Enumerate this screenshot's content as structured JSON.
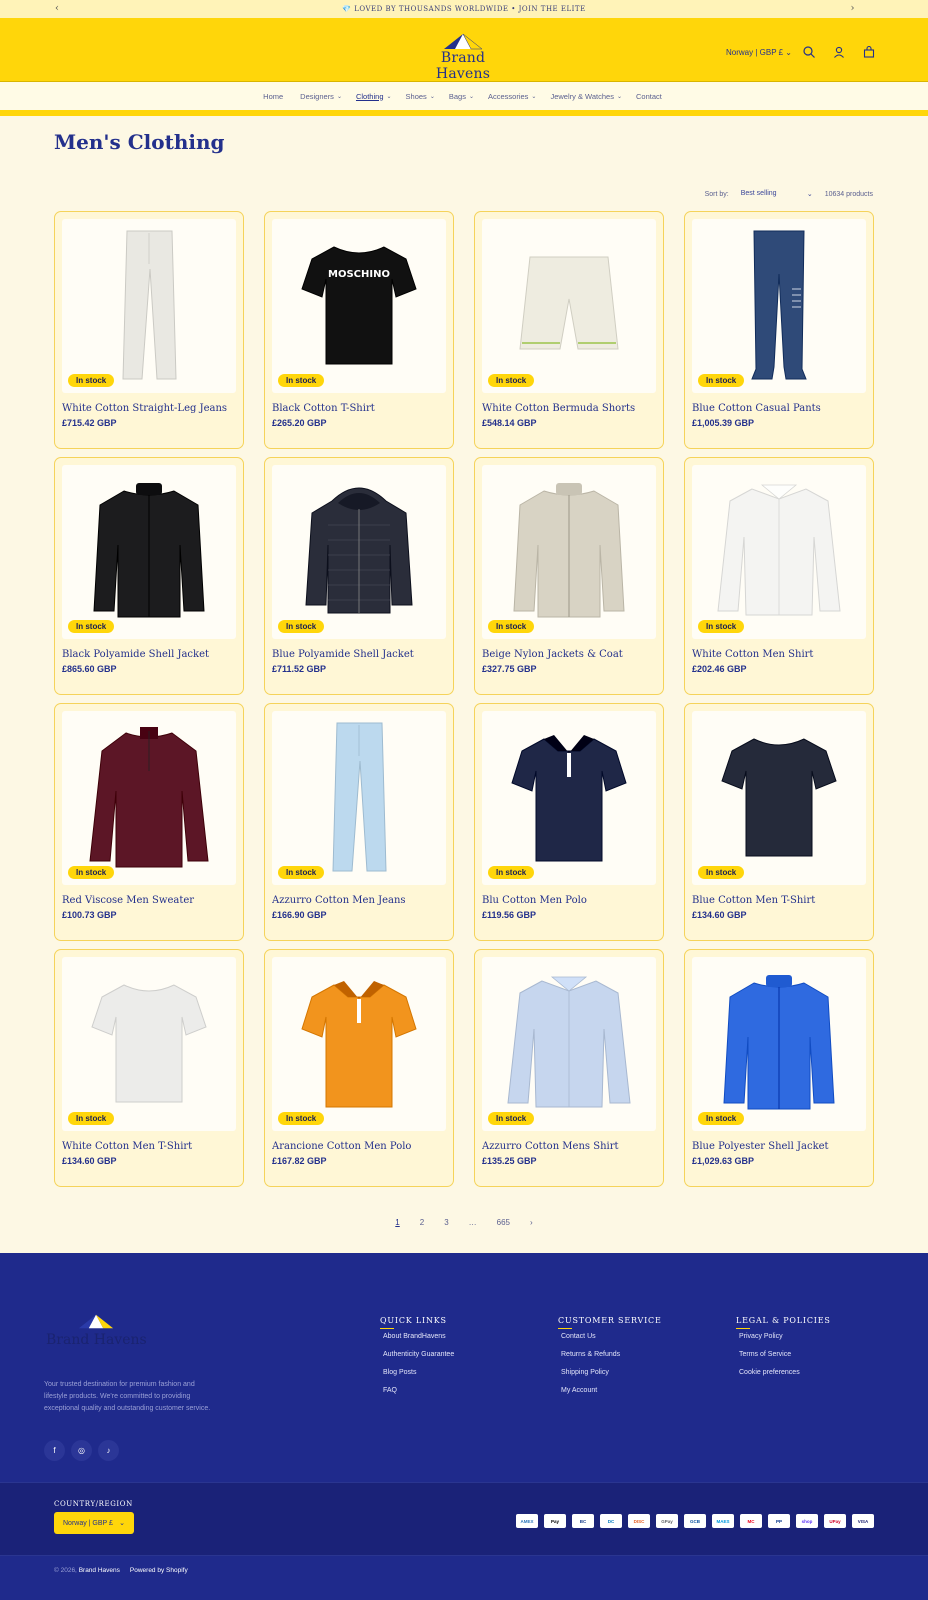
{
  "announcement": {
    "text": "💎 LOVED BY THOUSANDS WORLDWIDE • JOIN THE ELITE",
    "prev": "‹",
    "next": "›"
  },
  "header": {
    "brand": "Brand Havens",
    "locale": "Norway | GBP £"
  },
  "nav": [
    {
      "label": "Home",
      "chev": ""
    },
    {
      "label": "Designers",
      "chev": "⌄"
    },
    {
      "label": "Clothing",
      "chev": "⌄"
    },
    {
      "label": "Shoes",
      "chev": "⌄"
    },
    {
      "label": "Bags",
      "chev": "⌄"
    },
    {
      "label": "Accessories",
      "chev": "⌄"
    },
    {
      "label": "Jewelry & Watches",
      "chev": "⌄"
    },
    {
      "label": "Contact",
      "chev": ""
    }
  ],
  "page": {
    "title": "Men's Clothing"
  },
  "sort": {
    "label": "Sort by:",
    "value": "Best selling",
    "count": "10634 products"
  },
  "products": [
    {
      "name": "White Cotton Straight-Leg Jeans",
      "price": "£715.42 GBP",
      "badge": "In stock",
      "kind": "pants",
      "color": "#e9e8e2"
    },
    {
      "name": "Black Cotton T-Shirt",
      "price": "£265.20 GBP",
      "badge": "In stock",
      "kind": "tee",
      "color": "#111111",
      "print": "MOSCHINO"
    },
    {
      "name": "White Cotton Bermuda Shorts",
      "price": "£548.14 GBP",
      "badge": "In stock",
      "kind": "shorts",
      "color": "#eeece0"
    },
    {
      "name": "Blue Cotton Casual Pants",
      "price": "£1,005.39 GBP",
      "badge": "In stock",
      "kind": "joggers",
      "color": "#2f4a78"
    },
    {
      "name": "Black Polyamide Shell Jacket",
      "price": "£865.60 GBP",
      "badge": "In stock",
      "kind": "jacket",
      "color": "#1c1c1e"
    },
    {
      "name": "Blue Polyamide Shell Jacket",
      "price": "£711.52 GBP",
      "badge": "In stock",
      "kind": "hoodie",
      "color": "#2a2d3a"
    },
    {
      "name": "Beige Nylon Jackets & Coat",
      "price": "£327.75 GBP",
      "badge": "In stock",
      "kind": "jacket",
      "color": "#d8d3c4"
    },
    {
      "name": "White Cotton Men Shirt",
      "price": "£202.46 GBP",
      "badge": "In stock",
      "kind": "shirt",
      "color": "#f4f4f2"
    },
    {
      "name": "Red Viscose Men Sweater",
      "price": "£100.73 GBP",
      "badge": "In stock",
      "kind": "sweater",
      "color": "#5c1626"
    },
    {
      "name": "Azzurro Cotton Men Jeans",
      "price": "£166.90 GBP",
      "badge": "In stock",
      "kind": "pants",
      "color": "#bcd9ee"
    },
    {
      "name": "Blu Cotton Men Polo",
      "price": "£119.56 GBP",
      "badge": "In stock",
      "kind": "polo",
      "color": "#1f2747"
    },
    {
      "name": "Blue Cotton Men T-Shirt",
      "price": "£134.60 GBP",
      "badge": "In stock",
      "kind": "tee",
      "color": "#252a3a"
    },
    {
      "name": "White Cotton Men T-Shirt",
      "price": "£134.60 GBP",
      "badge": "In stock",
      "kind": "tee",
      "color": "#ececea"
    },
    {
      "name": "Arancione Cotton Men Polo",
      "price": "£167.82 GBP",
      "badge": "In stock",
      "kind": "polo",
      "color": "#f2941d"
    },
    {
      "name": "Azzurro Cotton Mens Shirt",
      "price": "£135.25 GBP",
      "badge": "In stock",
      "kind": "shirt",
      "color": "#c6d6ee"
    },
    {
      "name": "Blue Polyester Shell Jacket",
      "price": "£1,029.63 GBP",
      "badge": "In stock",
      "kind": "jacket",
      "color": "#2f6ae0"
    }
  ],
  "pagination": {
    "pages": [
      "1",
      "2",
      "3",
      "…",
      "665"
    ],
    "next": "›"
  },
  "footer": {
    "brand": "Brand Havens",
    "description": "Your trusted destination for premium fashion and lifestyle products. We're committed to providing exceptional quality and outstanding customer service.",
    "columns": [
      {
        "title": "QUICK LINKS",
        "links": [
          "About BrandHavens",
          "Authenticity Guarantee",
          "Blog Posts",
          "FAQ"
        ]
      },
      {
        "title": "CUSTOMER SERVICE",
        "links": [
          "Contact Us",
          "Returns & Refunds",
          "Shipping Policy",
          "My Account"
        ]
      },
      {
        "title": "LEGAL & POLICIES",
        "links": [
          "Privacy Policy",
          "Terms of Service",
          "Cookie preferences"
        ]
      }
    ],
    "country_label": "COUNTRY/REGION",
    "country_value": "Norway | GBP £",
    "payments": [
      "AMEX",
      "Pay",
      "BC",
      "DC",
      "DISC",
      "GPay",
      "GCB",
      "MAES",
      "MC",
      "PP",
      "shop",
      "UPay",
      "VISA"
    ],
    "copyright": "© 2026,",
    "copyright_brand": "Brand Havens",
    "powered": "Powered by Shopify"
  }
}
